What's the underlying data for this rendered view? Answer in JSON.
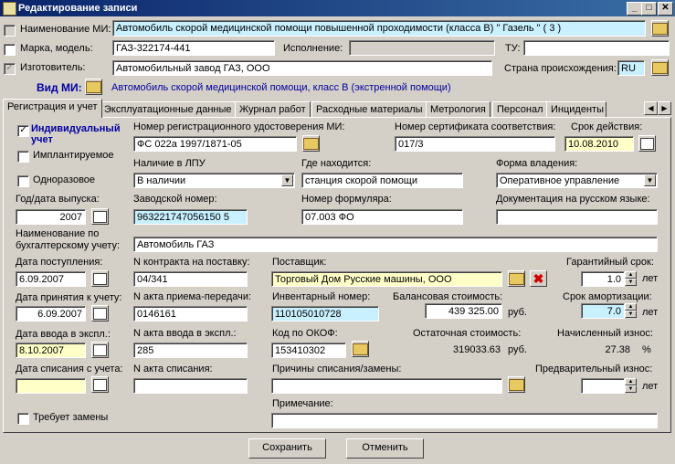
{
  "window": {
    "title": "Редактирование записи",
    "min": "_",
    "max": "□",
    "close": "✕"
  },
  "header": {
    "name_label": "Наименование МИ:",
    "name_value": "Автомобиль скорой медицинской помощи повышенной проходимости (класса В) \" Газель \" ( 3 )",
    "model_label": "Марка, модель:",
    "model_value": "ГАЗ-322174-441",
    "exec_label": "Исполнение:",
    "exec_value": "",
    "tu_label": "ТУ:",
    "tu_value": "",
    "maker_label": "Изготовитель:",
    "maker_value": "Автомобильный завод ГАЗ, ООО",
    "country_label": "Страна происхождения:",
    "country_value": "RU",
    "type_label": "Вид МИ:",
    "type_value": "Автомобиль скорой медицинской помощи, класс В (экстренной помощи)"
  },
  "tabs": [
    "Регистрация и учет",
    "Эксплуатационные данные",
    "Журнал работ",
    "Расходные материалы",
    "Метрология",
    "Персонал",
    "Инциденты"
  ],
  "reg": {
    "individual_label": "Индивидуальный учет",
    "implant_label": "Имплантируемое",
    "onetime_label": "Одноразовое",
    "regnum_label": "Номер регистрационного удостоверения МИ:",
    "regnum_value": "ФС 022а 1997/1871-05",
    "cert_label": "Номер сертификата соответствия:",
    "cert_value": "017/3",
    "valid_label": "Срок действия:",
    "valid_value": "10.08.2010",
    "inlpu_label": "Наличие в ЛПУ",
    "inlpu_value": "В наличии",
    "where_label": "Где находится:",
    "where_value": "станция скорой помощи",
    "ownership_label": "Форма владения:",
    "ownership_value": "Оперативное управление",
    "year_label": "Год/дата выпуска:",
    "year_value": "2007",
    "serial_label": "Заводской номер:",
    "serial_value": "963221747056150 5",
    "form_label": "Номер формуляра:",
    "form_value": "07.003 ФО",
    "docs_label": "Документация на русском языке:",
    "docs_value": "",
    "acc_name_label": "Наименование по бухгалтерскому учету:",
    "acc_name_value": "Автомобиль ГАЗ",
    "arrival_label": "Дата поступления:",
    "arrival_value": "6.09.2007",
    "contract_label": "N контракта на поставку:",
    "contract_value": "04/341",
    "supplier_label": "Поставщик:",
    "supplier_value": "Торговый Дом Русские машины, ООО",
    "warranty_label": "Гарантийный срок:",
    "warranty_value": "1.0",
    "years_unit": "лет",
    "accept_label": "Дата принятия к учету:",
    "accept_value": "6.09.2007",
    "act_transfer_label": "N акта приема-передачи:",
    "act_transfer_value": "0146161",
    "inventory_label": "Инвентарный номер:",
    "inventory_value": "110105010728",
    "balance_label": "Балансовая стоимость:",
    "balance_value": "439 325.00",
    "rub_unit": "руб.",
    "amort_label": "Срок амортизации:",
    "amort_value": "7.0",
    "commission_label": "Дата ввода в экспл.:",
    "commission_value": "8.10.2007",
    "act_commission_label": "N акта ввода в экспл.:",
    "act_commission_value": "285",
    "okof_label": "Код по ОКОФ:",
    "okof_value": "153410302",
    "residual_label": "Остаточная стоимость:",
    "residual_value": "319033.63",
    "wear_label": "Начисленный износ:",
    "wear_value": "27.38",
    "pct_unit": "%",
    "writeoff_label": "Дата списания с учета:",
    "writeoff_value": "",
    "act_writeoff_label": "N акта списания:",
    "act_writeoff_value": "",
    "reason_label": "Причины списания/замены:",
    "reason_value": "",
    "prewear_label": "Предварительный износ:",
    "prewear_value": "",
    "note_label": "Примечание:",
    "note_value": "",
    "replace_label": "Требует замены"
  },
  "buttons": {
    "save": "Сохранить",
    "cancel": "Отменить"
  }
}
